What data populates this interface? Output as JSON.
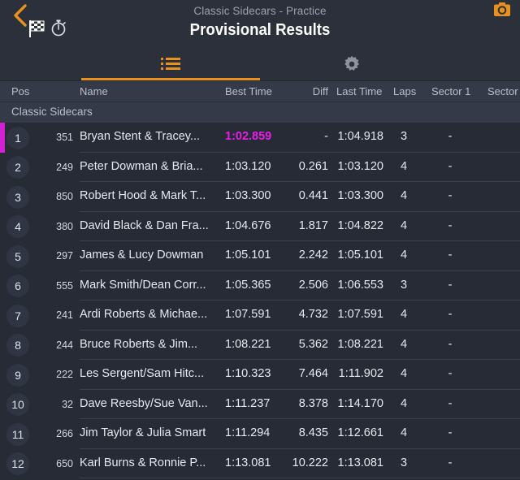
{
  "header": {
    "subtitle": "Classic Sidecars - Practice",
    "title": "Provisional Results",
    "back_icon": "chevron-left-icon",
    "flag_icon": "checkered-flag-icon",
    "stopwatch_icon": "stopwatch-icon",
    "camera_icon": "camera-icon",
    "accent_color": "#e8911f"
  },
  "tabs": [
    {
      "name": "results-list",
      "icon": "list-icon",
      "active": true
    },
    {
      "name": "settings",
      "icon": "gear-icon",
      "active": false
    }
  ],
  "table": {
    "columns": [
      "Pos",
      "Name",
      "Best Time",
      "Diff",
      "Last Time",
      "Laps",
      "Sector 1",
      "Sector"
    ],
    "group_label": "Classic Sidecars",
    "fastest_color": "#e81ee8",
    "rows": [
      {
        "pos": "1",
        "num": "351",
        "name": "Bryan Stent & Tracey...",
        "best": "1:02.859",
        "diff": "-",
        "last": "1:04.918",
        "laps": "3",
        "s1": "-",
        "s2": "",
        "fastest": true
      },
      {
        "pos": "2",
        "num": "249",
        "name": "Peter Dowman & Bria...",
        "best": "1:03.120",
        "diff": "0.261",
        "last": "1:03.120",
        "laps": "4",
        "s1": "-",
        "s2": "",
        "fastest": false
      },
      {
        "pos": "3",
        "num": "850",
        "name": "Robert Hood & Mark T...",
        "best": "1:03.300",
        "diff": "0.441",
        "last": "1:03.300",
        "laps": "4",
        "s1": "-",
        "s2": "",
        "fastest": false
      },
      {
        "pos": "4",
        "num": "380",
        "name": "David Black & Dan Fra...",
        "best": "1:04.676",
        "diff": "1.817",
        "last": "1:04.822",
        "laps": "4",
        "s1": "-",
        "s2": "",
        "fastest": false
      },
      {
        "pos": "5",
        "num": "297",
        "name": "James & Lucy Dowman",
        "best": "1:05.101",
        "diff": "2.242",
        "last": "1:05.101",
        "laps": "4",
        "s1": "-",
        "s2": "",
        "fastest": false
      },
      {
        "pos": "6",
        "num": "555",
        "name": "Mark Smith/Dean Corr...",
        "best": "1:05.365",
        "diff": "2.506",
        "last": "1:06.553",
        "laps": "3",
        "s1": "-",
        "s2": "",
        "fastest": false
      },
      {
        "pos": "7",
        "num": "241",
        "name": "Ardi Roberts & Michae...",
        "best": "1:07.591",
        "diff": "4.732",
        "last": "1:07.591",
        "laps": "4",
        "s1": "-",
        "s2": "",
        "fastest": false
      },
      {
        "pos": "8",
        "num": "244",
        "name": "Bruce Roberts & Jim...",
        "best": "1:08.221",
        "diff": "5.362",
        "last": "1:08.221",
        "laps": "4",
        "s1": "-",
        "s2": "",
        "fastest": false
      },
      {
        "pos": "9",
        "num": "222",
        "name": "Les Sergent/Sam Hitc...",
        "best": "1:10.323",
        "diff": "7.464",
        "last": "1:11.902",
        "laps": "4",
        "s1": "-",
        "s2": "",
        "fastest": false
      },
      {
        "pos": "10",
        "num": "32",
        "name": "Dave Reesby/Sue Van...",
        "best": "1:11.237",
        "diff": "8.378",
        "last": "1:14.170",
        "laps": "4",
        "s1": "-",
        "s2": "",
        "fastest": false
      },
      {
        "pos": "11",
        "num": "266",
        "name": "Jim Taylor & Julia Smart",
        "best": "1:11.294",
        "diff": "8.435",
        "last": "1:12.661",
        "laps": "4",
        "s1": "-",
        "s2": "",
        "fastest": false
      },
      {
        "pos": "12",
        "num": "650",
        "name": "Karl Burns & Ronnie P...",
        "best": "1:13.081",
        "diff": "10.222",
        "last": "1:13.081",
        "laps": "3",
        "s1": "-",
        "s2": "",
        "fastest": false
      }
    ]
  }
}
